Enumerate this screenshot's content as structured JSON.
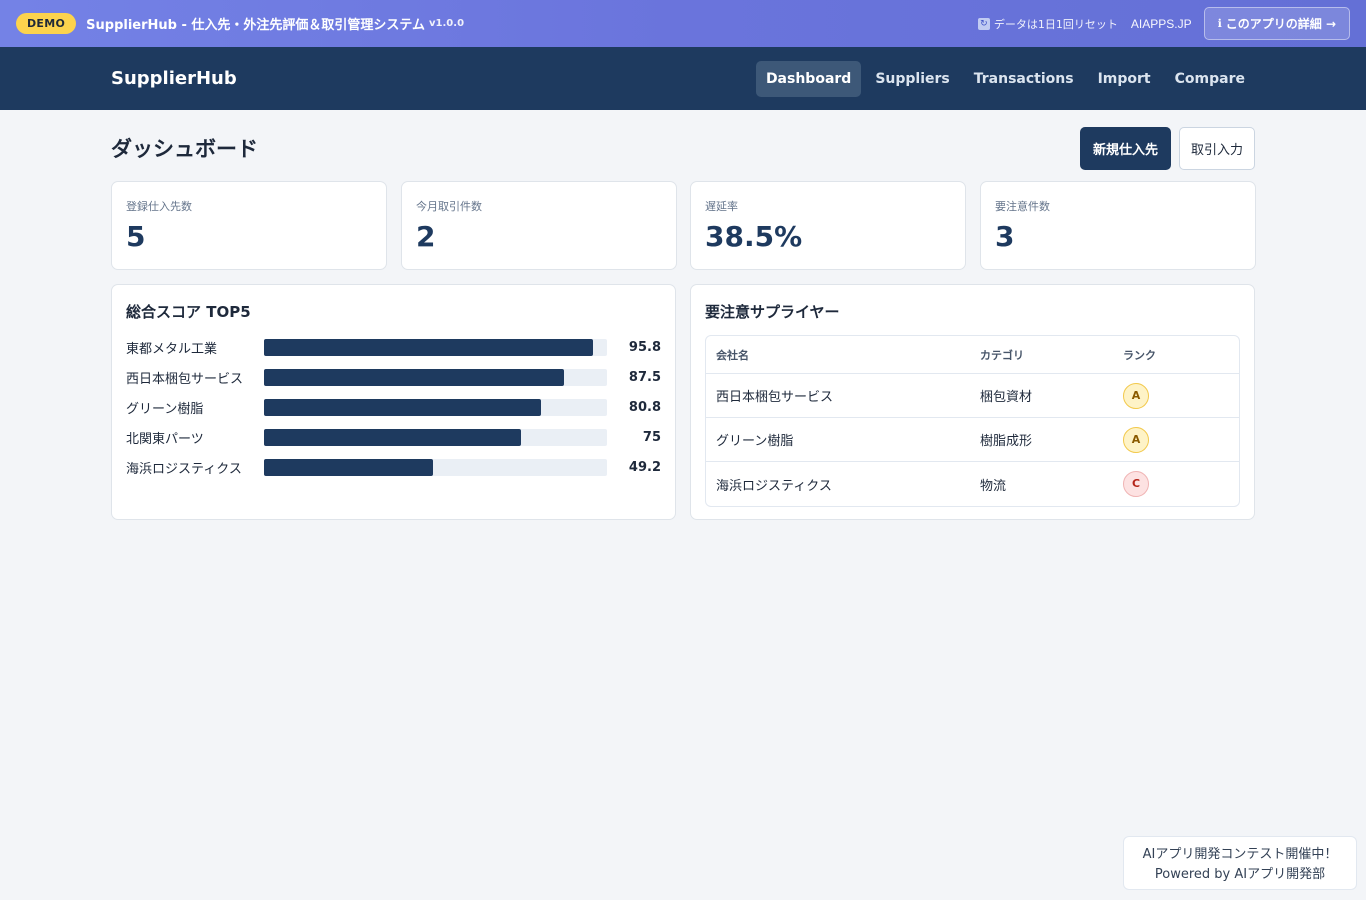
{
  "demo_bar": {
    "badge": "DEMO",
    "title": "SupplierHub - 仕入先・外注先評価＆取引管理システム",
    "version": "v1.0.0",
    "reset_note": "データは1日1回リセット",
    "site_link": "AIAPPS.JP",
    "detail_button": "このアプリの詳細 →",
    "icons": {
      "reset": "refresh-icon",
      "info": "info-icon"
    }
  },
  "navbar": {
    "brand": "SupplierHub",
    "items": [
      {
        "label": "Dashboard",
        "active": true
      },
      {
        "label": "Suppliers",
        "active": false
      },
      {
        "label": "Transactions",
        "active": false
      },
      {
        "label": "Import",
        "active": false
      },
      {
        "label": "Compare",
        "active": false
      }
    ]
  },
  "page": {
    "title": "ダッシュボード",
    "new_supplier_button": "新規仕入先",
    "transaction_input_button": "取引入力"
  },
  "stats": [
    {
      "label": "登録仕入先数",
      "value": "5"
    },
    {
      "label": "今月取引件数",
      "value": "2"
    },
    {
      "label": "遅延率",
      "value": "38.5%"
    },
    {
      "label": "要注意件数",
      "value": "3"
    }
  ],
  "score_top5": {
    "title": "総合スコア TOP5",
    "items": [
      {
        "name": "東都メタル工業",
        "score": "95.8",
        "fill": 0.958
      },
      {
        "name": "西日本梱包サービス",
        "score": "87.5",
        "fill": 0.875
      },
      {
        "name": "グリーン樹脂",
        "score": "80.8",
        "fill": 0.808
      },
      {
        "name": "北関東パーツ",
        "score": "75",
        "fill": 0.75
      },
      {
        "name": "海浜ロジスティクス",
        "score": "49.2",
        "fill": 0.492
      }
    ]
  },
  "watch_suppliers": {
    "title": "要注意サプライヤー",
    "columns": [
      "会社名",
      "カテゴリ",
      "ランク"
    ],
    "rows": [
      {
        "name": "西日本梱包サービス",
        "category": "梱包資材",
        "rank": "A"
      },
      {
        "name": "グリーン樹脂",
        "category": "樹脂成形",
        "rank": "A"
      },
      {
        "name": "海浜ロジスティクス",
        "category": "物流",
        "rank": "C"
      }
    ]
  },
  "promo": {
    "line1": "AIアプリ開発コンテスト開催中！",
    "line2": "Powered by AIアプリ開発部"
  },
  "colors": {
    "navbar": "#1e3a5f",
    "accent": "#1e3a5f",
    "demo_badge": "#fcd34d",
    "rank_a": "#fef3c7",
    "rank_c": "#fde2e2"
  }
}
